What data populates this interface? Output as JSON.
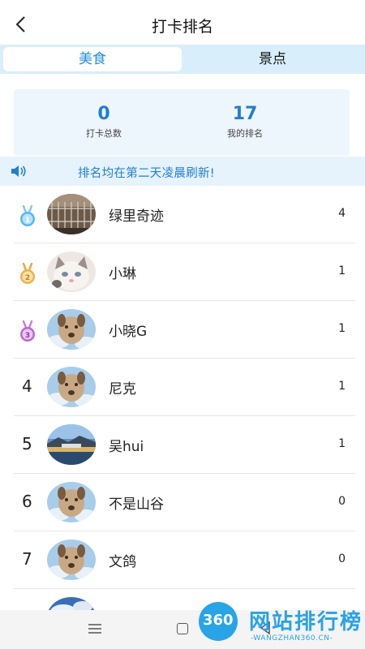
{
  "header": {
    "title": "打卡排名",
    "back_icon": "chevron-left-icon"
  },
  "tabs": [
    {
      "label": "美食",
      "active": true
    },
    {
      "label": "景点",
      "active": false
    }
  ],
  "stats": [
    {
      "value": "0",
      "label": "打卡总数"
    },
    {
      "value": "17",
      "label": "我的排名"
    }
  ],
  "notice": {
    "text": "排名均在第二天凌晨刷新!",
    "icon": "speaker-icon"
  },
  "ranking": [
    {
      "rank": "1",
      "medal": "blue",
      "name": "绿里奇迹",
      "count": "4",
      "avatar": "cage"
    },
    {
      "rank": "2",
      "medal": "gold",
      "name": "小琳",
      "count": "1",
      "avatar": "cat"
    },
    {
      "rank": "3",
      "medal": "purple",
      "name": "小晓G",
      "count": "1",
      "avatar": "dog"
    },
    {
      "rank": "4",
      "medal": "",
      "name": "尼克",
      "count": "1",
      "avatar": "dog"
    },
    {
      "rank": "5",
      "medal": "",
      "name": "吴hui",
      "count": "1",
      "avatar": "landscape"
    },
    {
      "rank": "6",
      "medal": "",
      "name": "不是山谷",
      "count": "0",
      "avatar": "dog"
    },
    {
      "rank": "7",
      "medal": "",
      "name": "文鸽",
      "count": "0",
      "avatar": "dog"
    },
    {
      "rank": "",
      "medal": "",
      "name": "",
      "count": "",
      "avatar": "sky"
    }
  ],
  "bottom_nav": {
    "menu_icon": "menu-icon",
    "home_icon": "home-square-icon",
    "back_icon": "back-triangle-icon"
  },
  "watermark": {
    "badge": "360",
    "title": "网站排行榜",
    "subtitle": "-WANGZHAN360.CN-"
  },
  "colors": {
    "accent": "#1f7fcf",
    "tab_bg": "#d8eefb",
    "notice_bg": "#e6f2fc"
  }
}
